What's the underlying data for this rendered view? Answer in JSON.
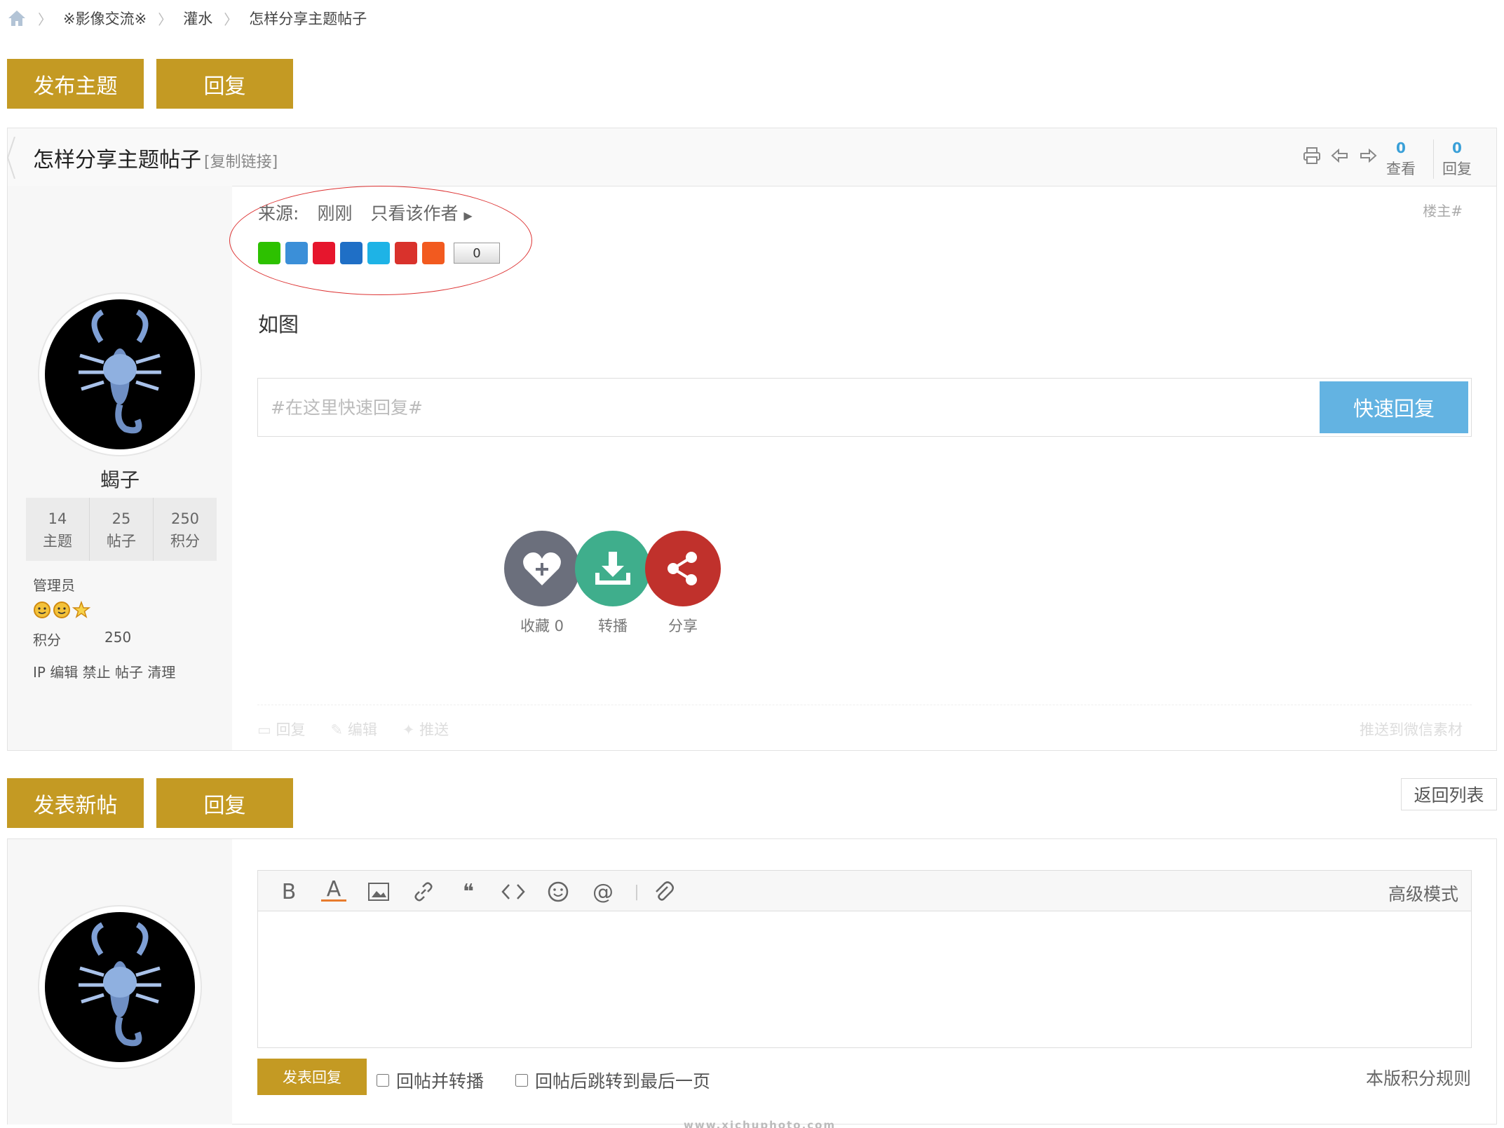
{
  "breadcrumb": {
    "items": [
      "※影像交流※",
      "灌水",
      "怎样分享主题帖子"
    ]
  },
  "top_buttons": {
    "new_topic": "发布主题",
    "reply": "回复"
  },
  "thread": {
    "title": "怎样分享主题帖子",
    "copy_link": "[复制链接]",
    "views_count": "0",
    "views_label": "查看",
    "replies_count": "0",
    "replies_label": "回复"
  },
  "author": {
    "name": "蝎子",
    "stats": [
      {
        "value": "14",
        "label": "主题"
      },
      {
        "value": "25",
        "label": "帖子"
      },
      {
        "value": "250",
        "label": "积分"
      }
    ],
    "role": "管理员",
    "points_label": "积分",
    "points_value": "250",
    "admin_links": "IP 编辑 禁止 帖子 清理"
  },
  "post": {
    "source_label": "来源:",
    "time": "刚刚",
    "only_author": "只看该作者",
    "floor": "楼主#",
    "share_count": "0",
    "content": "如图"
  },
  "quick_reply": {
    "placeholder": "#在这里快速回复#",
    "button": "快速回复"
  },
  "actions": {
    "favorite": "收藏 0",
    "forward": "转播",
    "share": "分享"
  },
  "post_footer": {
    "reply": "回复",
    "edit": "编辑",
    "push": "推送",
    "push_wechat": "推送到微信素材"
  },
  "bottom_buttons": {
    "new_post": "发表新帖",
    "reply": "回复",
    "return_list": "返回列表"
  },
  "editor": {
    "advanced_mode": "高级模式",
    "submit": "发表回复",
    "opt_forward": "回帖并转播",
    "opt_jump_last": "回帖后跳转到最后一页",
    "rules": "本版积分规则"
  },
  "watermark": "www.xichuphoto.com",
  "colors": {
    "gold": "#c49a23",
    "blue": "#63b3e2",
    "favorite": "#6b6f7c",
    "forward": "#3fae8c",
    "share": "#c0312c"
  }
}
